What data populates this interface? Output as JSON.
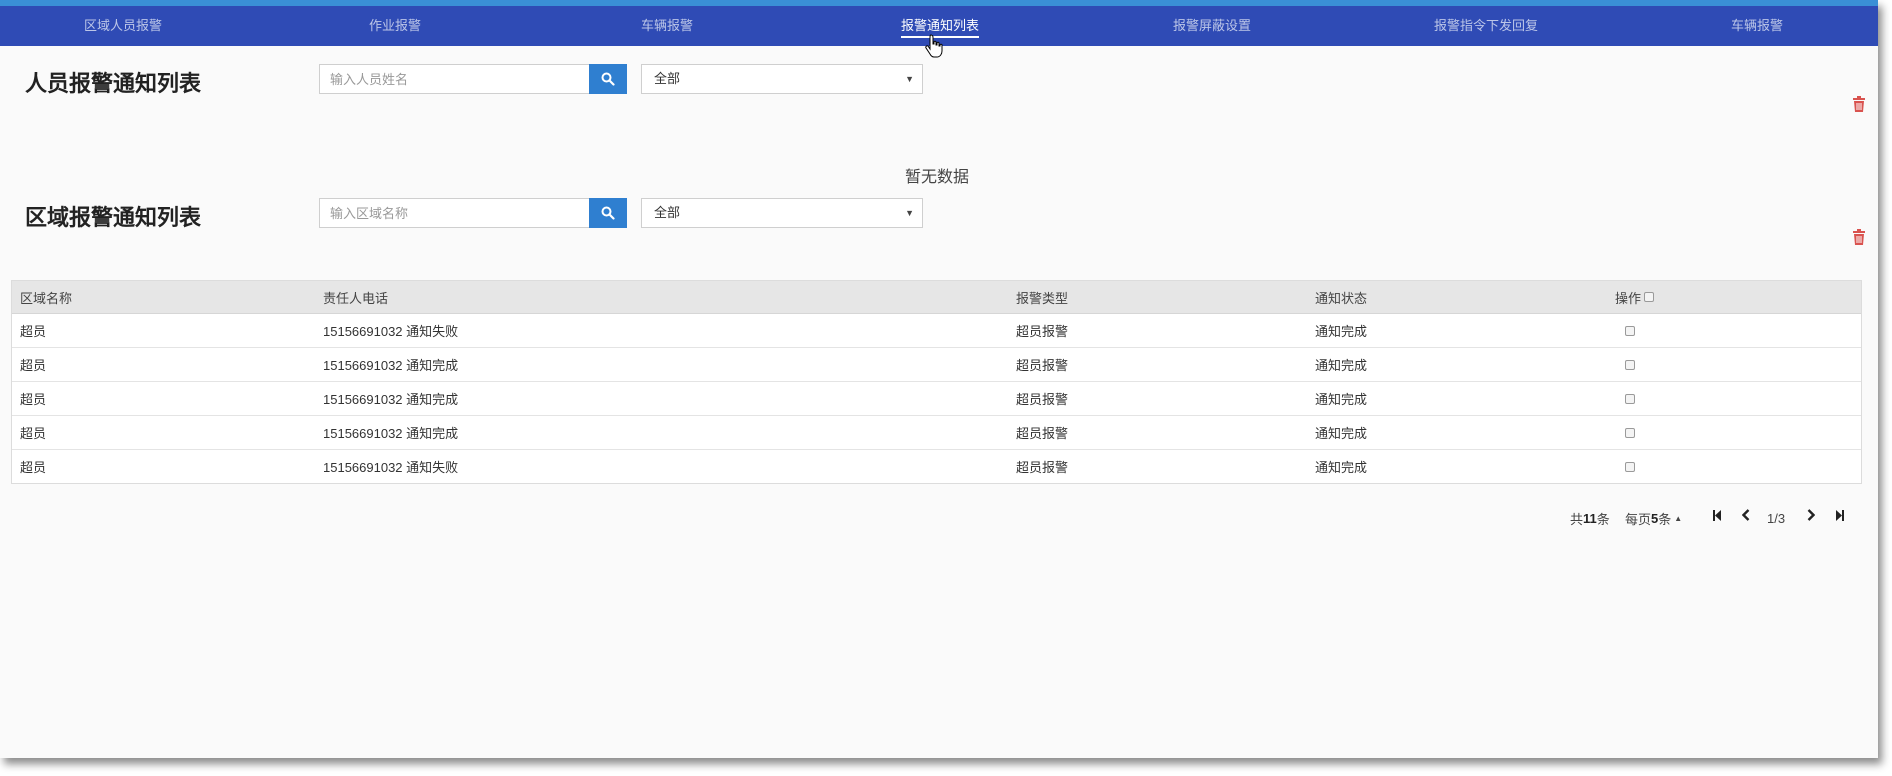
{
  "nav": {
    "items": [
      {
        "label": "区域人员报警"
      },
      {
        "label": "作业报警"
      },
      {
        "label": "车辆报警"
      },
      {
        "label": "报警通知列表"
      },
      {
        "label": "报警屏蔽设置"
      },
      {
        "label": "报警指令下发回复"
      },
      {
        "label": "车辆报警"
      }
    ],
    "active_index": 3
  },
  "person_section": {
    "title": "人员报警通知列表",
    "search_placeholder": "输入人员姓名",
    "filter_value": "全部",
    "empty_text": "暂无数据"
  },
  "area_section": {
    "title": "区域报警通知列表",
    "search_placeholder": "输入区域名称",
    "filter_value": "全部"
  },
  "table": {
    "headers": [
      "区域名称",
      "责任人电话",
      "报警类型",
      "通知状态",
      "操作"
    ],
    "rows": [
      {
        "area": "超员",
        "phone": "15156691032 通知失败",
        "type": "超员报警",
        "status": "通知完成"
      },
      {
        "area": "超员",
        "phone": "15156691032 通知完成",
        "type": "超员报警",
        "status": "通知完成"
      },
      {
        "area": "超员",
        "phone": "15156691032 通知完成",
        "type": "超员报警",
        "status": "通知完成"
      },
      {
        "area": "超员",
        "phone": "15156691032 通知完成",
        "type": "超员报警",
        "status": "通知完成"
      },
      {
        "area": "超员",
        "phone": "15156691032 通知失败",
        "type": "超员报警",
        "status": "通知完成"
      }
    ]
  },
  "pagination": {
    "total_prefix": "共",
    "total": "11",
    "total_suffix": "条",
    "per_page_prefix": "每页",
    "per_page": "5",
    "per_page_suffix": "条",
    "page_indicator": "1/3"
  },
  "colors": {
    "navbar": "#2f4bb5",
    "accent": "#2f7fd0",
    "danger": "#d9534f"
  }
}
